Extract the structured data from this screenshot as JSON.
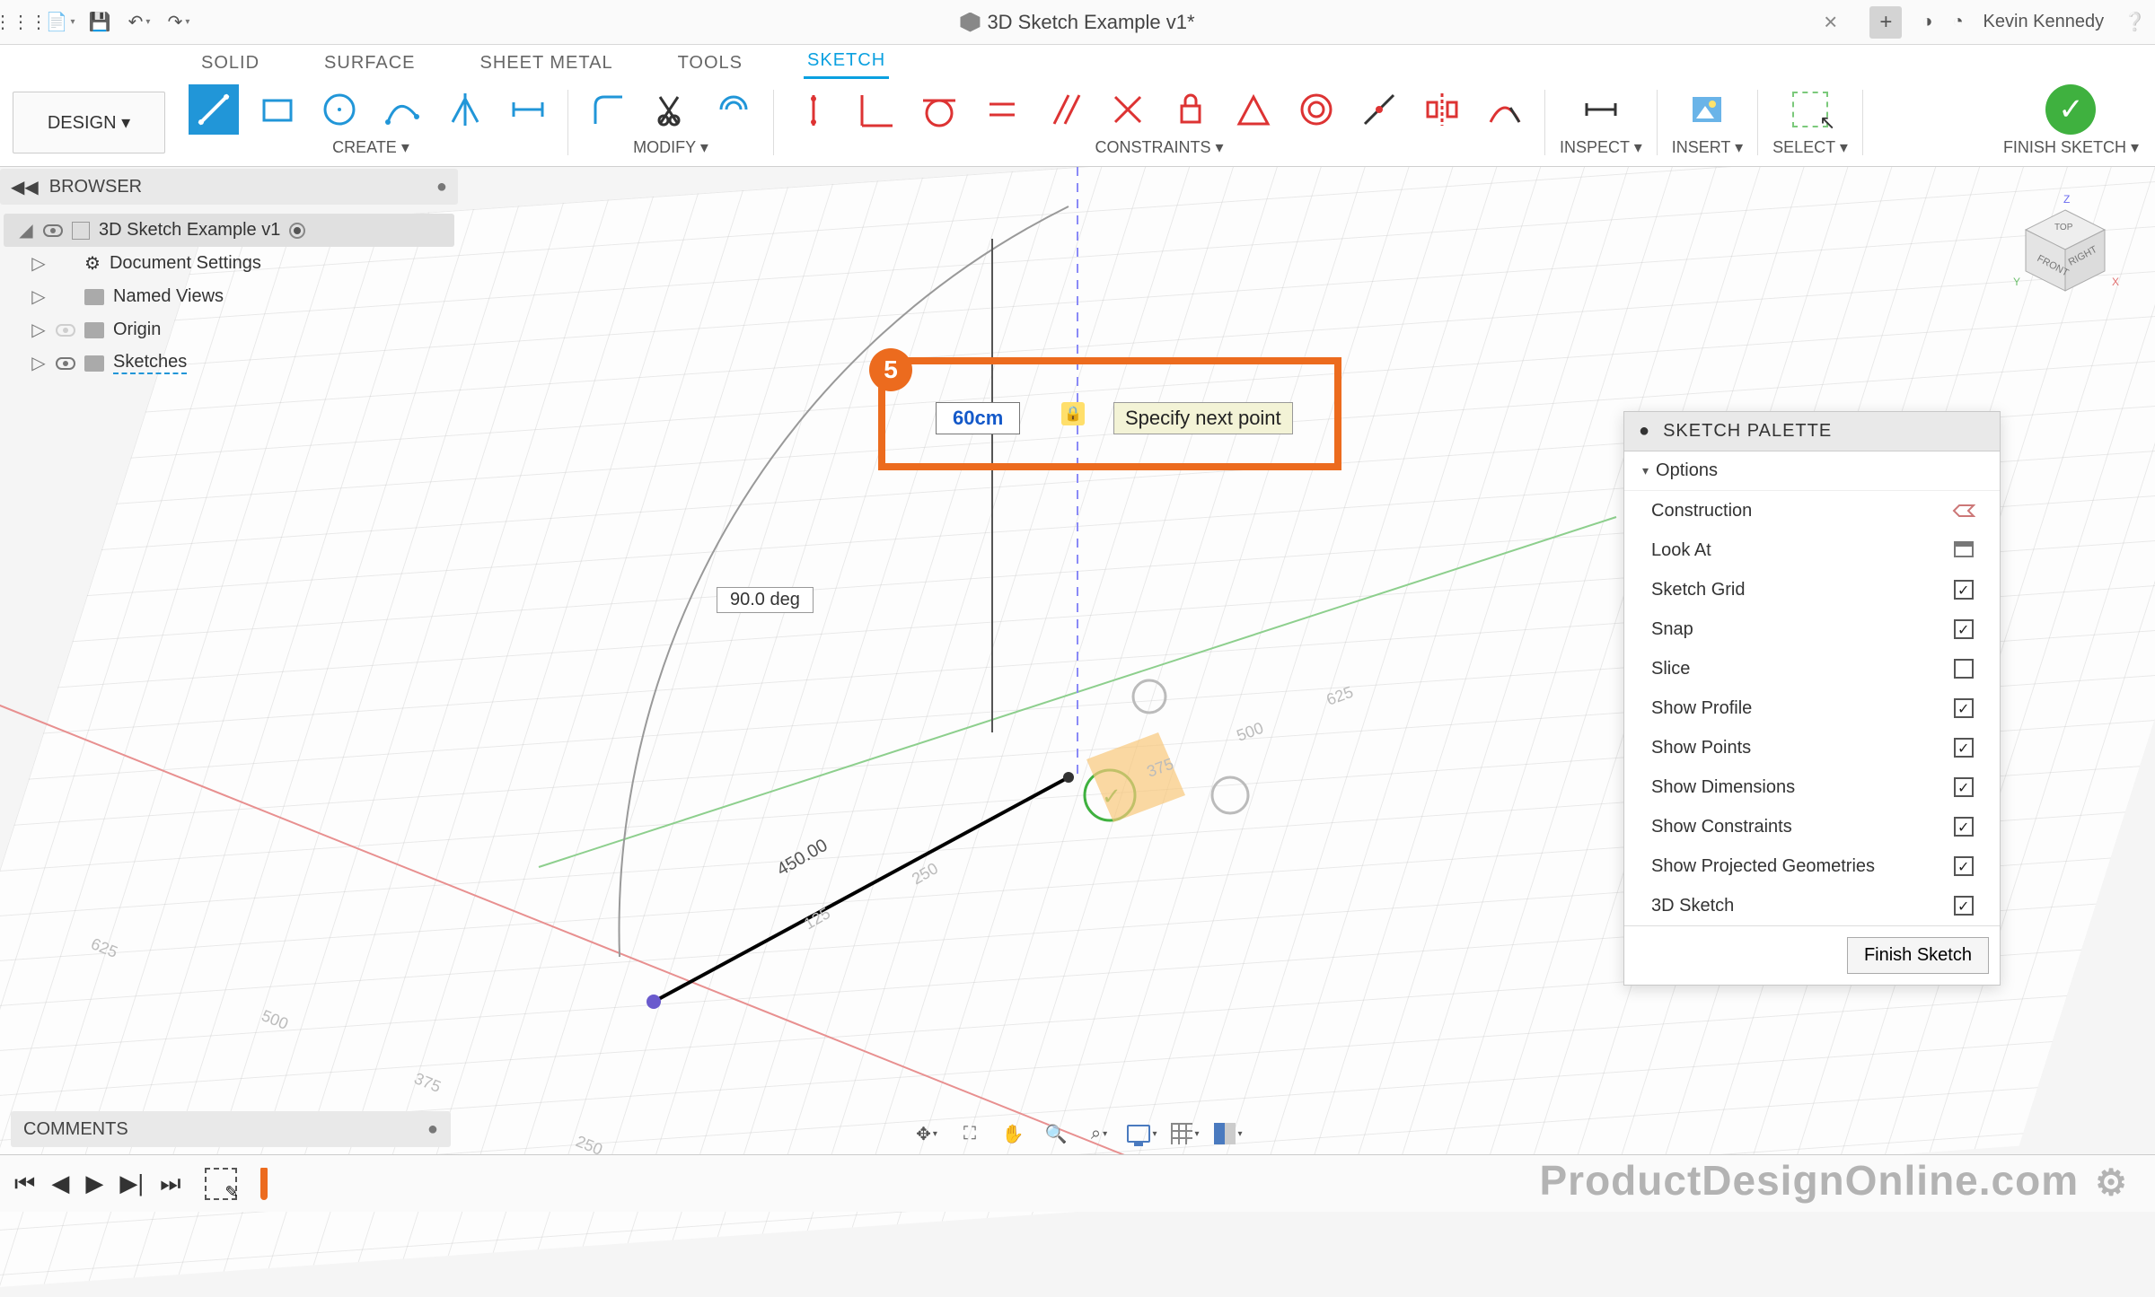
{
  "titlebar": {
    "doc_title": "3D Sketch Example v1*",
    "user": "Kevin Kennedy"
  },
  "tabs": {
    "solid": "SOLID",
    "surface": "SURFACE",
    "sheetmetal": "SHEET METAL",
    "tools": "TOOLS",
    "sketch": "SKETCH"
  },
  "ribbon": {
    "design": "DESIGN ▾",
    "create": "CREATE ▾",
    "modify": "MODIFY ▾",
    "constraints": "CONSTRAINTS ▾",
    "inspect": "INSPECT ▾",
    "insert": "INSERT ▾",
    "select": "SELECT ▾",
    "finish": "FINISH SKETCH ▾"
  },
  "browser": {
    "title": "BROWSER",
    "root": "3D Sketch Example v1",
    "items": [
      {
        "label": "Document Settings"
      },
      {
        "label": "Named Views"
      },
      {
        "label": "Origin"
      },
      {
        "label": "Sketches"
      }
    ]
  },
  "callout": {
    "number": "5",
    "dim_value": "60cm",
    "tooltip": "Specify next point"
  },
  "canvas_labels": {
    "angle": "90.0 deg",
    "length": "450.00",
    "ticks": [
      "125",
      "250",
      "375",
      "500",
      "625",
      "125",
      "250",
      "375",
      "500",
      "625"
    ]
  },
  "palette": {
    "title": "SKETCH PALETTE",
    "section": "Options",
    "rows": [
      {
        "label": "Construction",
        "type": "icon"
      },
      {
        "label": "Look At",
        "type": "icon"
      },
      {
        "label": "Sketch Grid",
        "type": "check",
        "on": true
      },
      {
        "label": "Snap",
        "type": "check",
        "on": true
      },
      {
        "label": "Slice",
        "type": "check",
        "on": false
      },
      {
        "label": "Show Profile",
        "type": "check",
        "on": true
      },
      {
        "label": "Show Points",
        "type": "check",
        "on": true
      },
      {
        "label": "Show Dimensions",
        "type": "check",
        "on": true
      },
      {
        "label": "Show Constraints",
        "type": "check",
        "on": true
      },
      {
        "label": "Show Projected Geometries",
        "type": "check",
        "on": true
      },
      {
        "label": "3D Sketch",
        "type": "check",
        "on": true
      }
    ],
    "finish_btn": "Finish Sketch"
  },
  "comments": {
    "title": "COMMENTS"
  },
  "viewcube": {
    "front": "FRONT",
    "right": "RIGHT",
    "top": "TOP",
    "x": "X",
    "y": "Y",
    "z": "Z"
  },
  "watermark": "ProductDesignOnline.com"
}
